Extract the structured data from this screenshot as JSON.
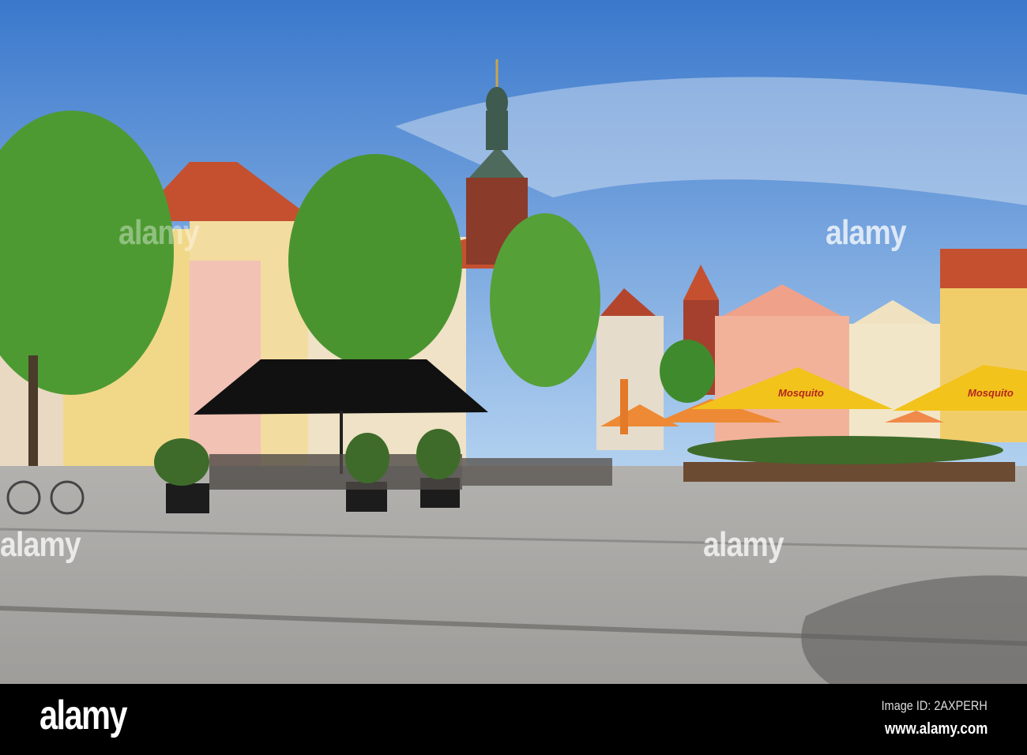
{
  "photo": {
    "subject": "Altmarkt town square with cafes",
    "colors": {
      "sky_top": "#3f7fd0",
      "sky_bottom": "#a9cbef",
      "pavement": "#a7a6a3",
      "tree": "#4e9a32",
      "roof": "#c5502f",
      "umbrella_yellow": "#f2c31b",
      "umbrella_orange": "#ee8a35",
      "umbrella_black": "#111111"
    }
  },
  "umbrella_text": [
    "Mosquito",
    "Mosquito"
  ],
  "watermarks": [
    "alamy",
    "alamy",
    "alamy",
    "alamy"
  ],
  "footer": {
    "logo": "alamy",
    "image_id": "Image ID: 2AXPERH",
    "url": "www.alamy.com"
  }
}
